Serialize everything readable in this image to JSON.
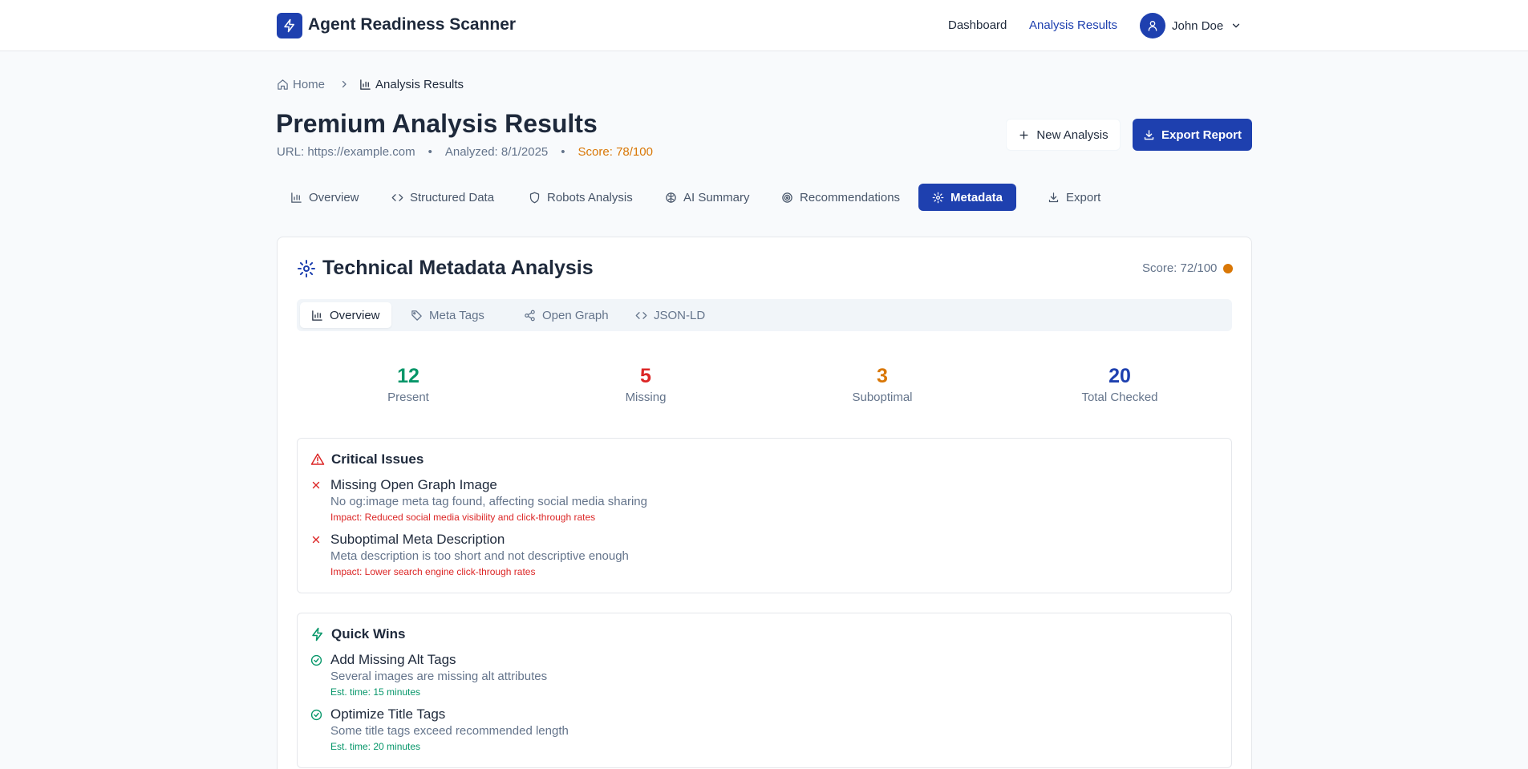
{
  "header": {
    "app_title": "Agent Readiness Scanner",
    "nav": {
      "dashboard": "Dashboard",
      "analysis_results": "Analysis Results"
    },
    "user": {
      "name": "John Doe"
    },
    "icons": {
      "logo": "lightning-icon",
      "avatar": "user-icon",
      "menu": "chevron-down-icon"
    }
  },
  "breadcrumb": {
    "home": "Home",
    "current": "Analysis Results"
  },
  "page": {
    "title": "Premium Analysis Results",
    "url": "URL: https://example.com",
    "analyzed": "Analyzed: 8/1/2025",
    "score": "Score: 78/100",
    "separator": "•"
  },
  "actions": {
    "new_analysis": "New Analysis",
    "export_report": "Export Report"
  },
  "tabs": [
    {
      "label": "Overview",
      "icon": "bar-chart-icon"
    },
    {
      "label": "Structured Data",
      "icon": "code-icon"
    },
    {
      "label": "Robots Analysis",
      "icon": "shield-icon"
    },
    {
      "label": "AI Summary",
      "icon": "brain-icon"
    },
    {
      "label": "Recommendations",
      "icon": "target-icon"
    },
    {
      "label": "Metadata",
      "icon": "gear-icon",
      "active": true
    },
    {
      "label": "Export",
      "icon": "download-icon"
    }
  ],
  "metadata": {
    "title": "Technical Metadata Analysis",
    "score": "Score: 72/100",
    "score_color": "#d97706",
    "subtabs": [
      {
        "label": "Overview",
        "icon": "bar-chart-icon",
        "active": true
      },
      {
        "label": "Meta Tags",
        "icon": "tag-icon"
      },
      {
        "label": "Open Graph",
        "icon": "share-icon"
      },
      {
        "label": "JSON-LD",
        "icon": "code-icon"
      }
    ],
    "stats": [
      {
        "value": "12",
        "label": "Present",
        "color": "#059669"
      },
      {
        "value": "5",
        "label": "Missing",
        "color": "#dc2626"
      },
      {
        "value": "3",
        "label": "Suboptimal",
        "color": "#d97706"
      },
      {
        "value": "20",
        "label": "Total Checked",
        "color": "#1e40af"
      }
    ],
    "critical": {
      "heading": "Critical Issues",
      "items": [
        {
          "title": "Missing Open Graph Image",
          "desc": "No og:image meta tag found, affecting social media sharing",
          "impact": "Impact: Reduced social media visibility and click-through rates"
        },
        {
          "title": "Suboptimal Meta Description",
          "desc": "Meta description is too short and not descriptive enough",
          "impact": "Impact: Lower search engine click-through rates"
        }
      ]
    },
    "quick_wins": {
      "heading": "Quick Wins",
      "items": [
        {
          "title": "Add Missing Alt Tags",
          "desc": "Several images are missing alt attributes",
          "time": "Est. time: 15 minutes"
        },
        {
          "title": "Optimize Title Tags",
          "desc": "Some title tags exceed recommended length",
          "time": "Est. time: 20 minutes"
        }
      ]
    }
  },
  "colors": {
    "primary": "#1e40af",
    "success": "#059669",
    "danger": "#dc2626",
    "warning": "#d97706"
  }
}
